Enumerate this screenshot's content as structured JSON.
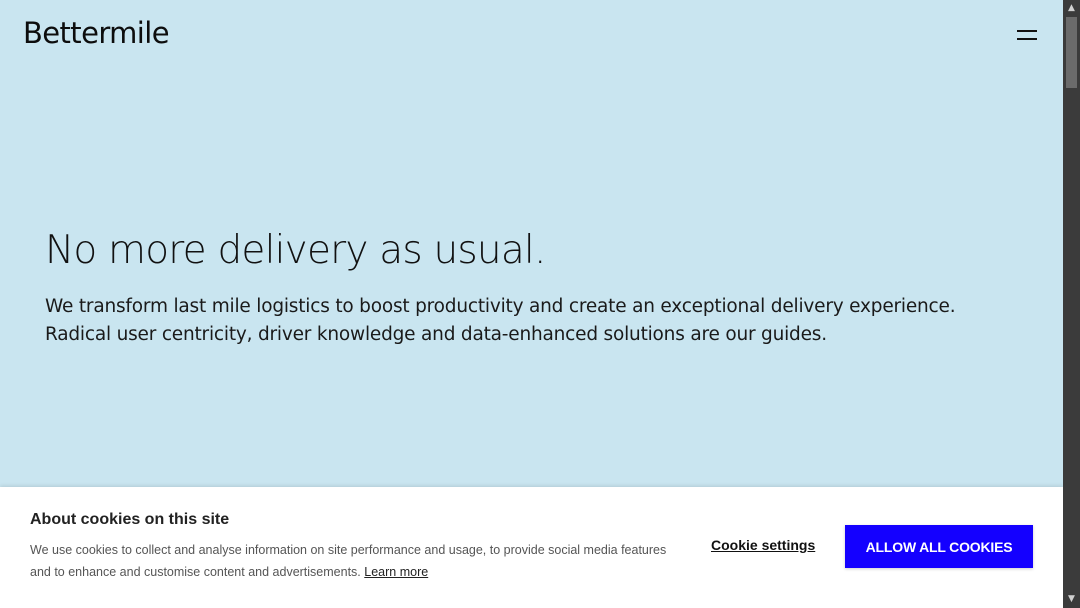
{
  "header": {
    "logo_text": "Bettermile",
    "menu_icon": "hamburger-menu-icon"
  },
  "hero": {
    "title": "No more delivery as usual.",
    "description": "We transform last mile logistics to boost productivity and create an exceptional delivery experience. Radical user centricity, driver knowledge and data-enhanced solutions are our guides."
  },
  "cookie_banner": {
    "title": "About cookies on this site",
    "text": "We use cookies to collect and analyse information on site performance and usage, to provide social media features and to enhance and customise content and advertisements.",
    "learn_more": "Learn more",
    "settings_label": "Cookie settings",
    "allow_label": "ALLOW ALL COOKIES"
  },
  "scrollbar": {
    "up_glyph": "▲",
    "down_glyph": "▼"
  },
  "colors": {
    "background": "#c9e5f0",
    "accent": "#1400ff"
  }
}
